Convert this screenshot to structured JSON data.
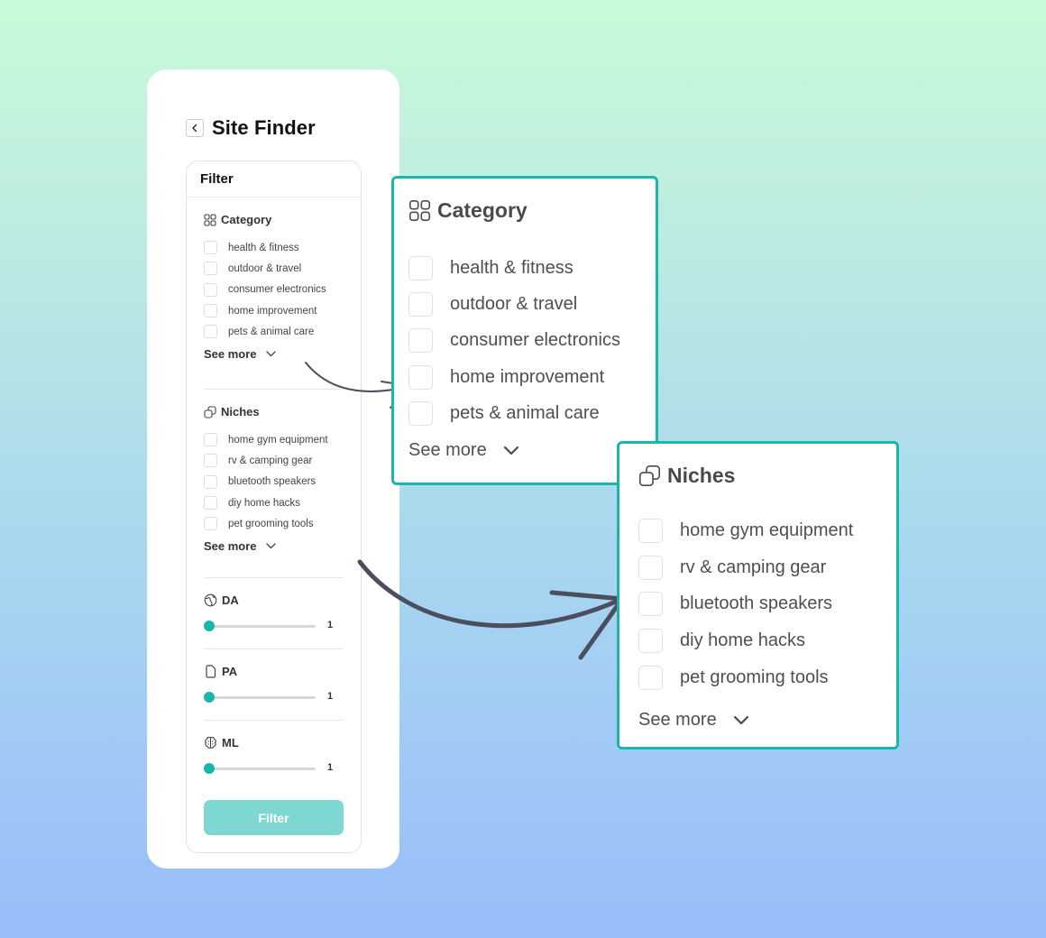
{
  "panel": {
    "title": "Site Finder",
    "filter_title": "Filter",
    "category": {
      "heading": "Category",
      "icon": "grid-icon",
      "items": [
        "health & fitness",
        "outdoor & travel",
        "consumer electronics",
        "home improvement",
        "pets & animal care"
      ],
      "see_more": "See more"
    },
    "niches": {
      "heading": "Niches",
      "icon": "copy-icon",
      "items": [
        "home gym equipment",
        "rv & camping gear",
        "bluetooth speakers",
        "diy home hacks",
        "pet grooming tools"
      ],
      "see_more": "See more"
    },
    "sliders": [
      {
        "label": "DA",
        "icon": "globe-icon",
        "value": "1"
      },
      {
        "label": "PA",
        "icon": "document-icon",
        "value": "1"
      },
      {
        "label": "ML",
        "icon": "brain-icon",
        "value": "1"
      }
    ],
    "filter_button": "Filter"
  },
  "zoom_category": {
    "heading": "Category",
    "items": [
      "health & fitness",
      "outdoor & travel",
      "consumer electronics",
      "home improvement",
      "pets & animal care"
    ],
    "see_more": "See more"
  },
  "zoom_niches": {
    "heading": "Niches",
    "items": [
      "home gym equipment",
      "rv & camping gear",
      "bluetooth speakers",
      "diy home hacks",
      "pet grooming tools"
    ],
    "see_more": "See more"
  },
  "colors": {
    "accent": "#19b6ab",
    "button": "#7fd7d2",
    "arrow": "#4a4e5e"
  }
}
